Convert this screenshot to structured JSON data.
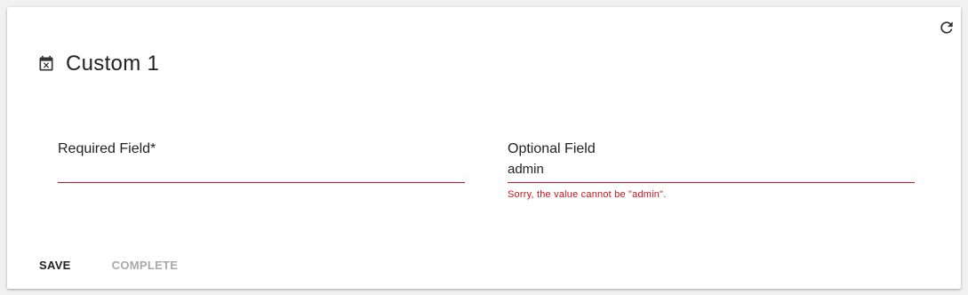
{
  "header": {
    "title": "Custom 1",
    "title_icon": "calendar-cancel-icon",
    "refresh_icon": "refresh-icon"
  },
  "form": {
    "required_field": {
      "label": "Required Field*",
      "value": ""
    },
    "optional_field": {
      "label": "Optional Field",
      "value": "admin",
      "error": "Sorry, the value cannot be \"admin\"."
    }
  },
  "actions": {
    "save_label": "SAVE",
    "complete_label": "COMPLETE"
  },
  "colors": {
    "error": "#c4161c",
    "text": "#222222",
    "disabled": "#a9a9a9",
    "background": "#ffffff"
  }
}
